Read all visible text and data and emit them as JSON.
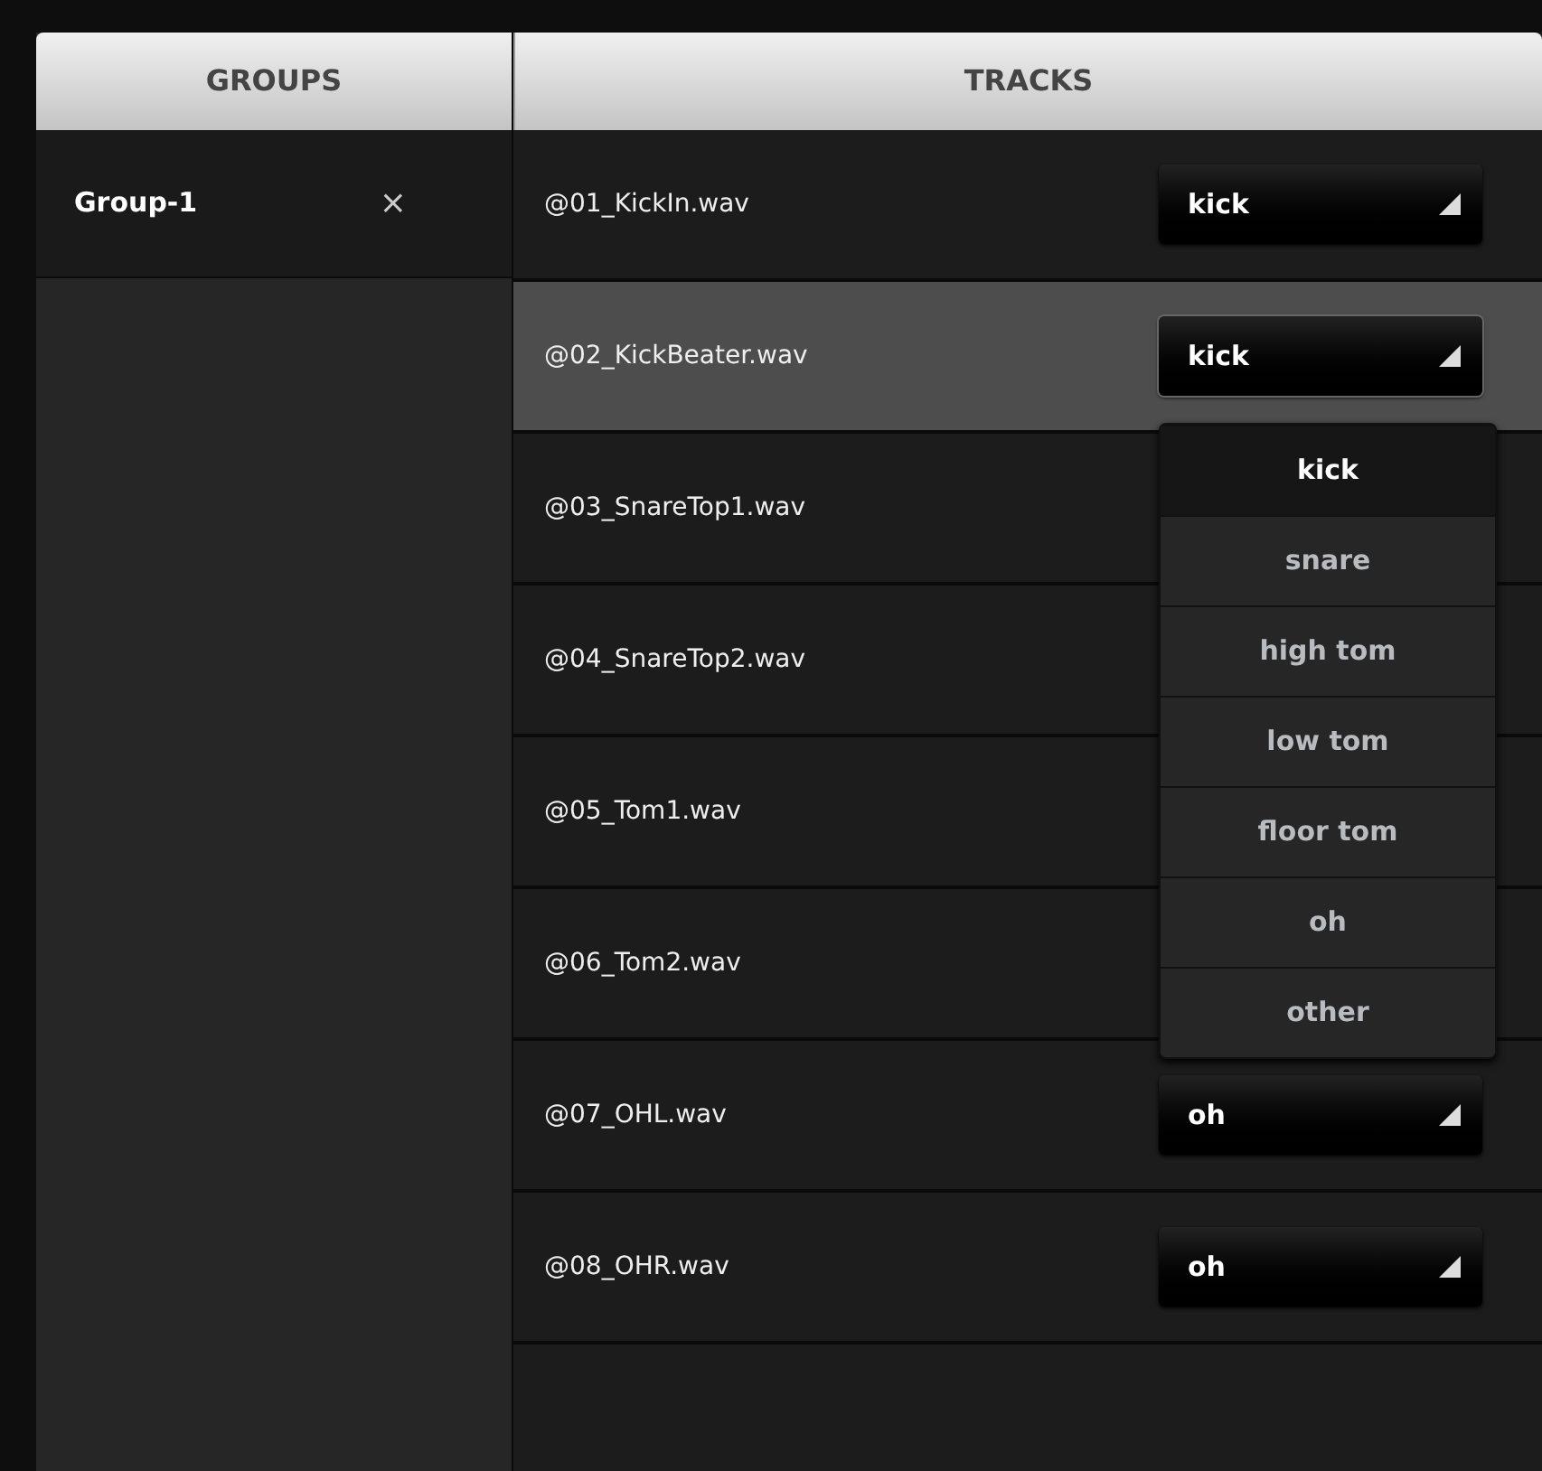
{
  "groups_header": "GROUPS",
  "tracks_header": "TRACKS",
  "groups": [
    {
      "name": "Group-1",
      "close": "×",
      "selected": true
    }
  ],
  "tracks": [
    {
      "name": "@01_KickIn.wav",
      "selected": false,
      "type": "kick"
    },
    {
      "name": "@02_KickBeater.wav",
      "selected": true,
      "type": "kick",
      "menu_open": true
    },
    {
      "name": "@03_SnareTop1.wav",
      "selected": false
    },
    {
      "name": "@04_SnareTop2.wav",
      "selected": false
    },
    {
      "name": "@05_Tom1.wav",
      "selected": false
    },
    {
      "name": "@06_Tom2.wav",
      "selected": false
    },
    {
      "name": "@07_OHL.wav",
      "selected": false,
      "type": "oh"
    },
    {
      "name": "@08_OHR.wav",
      "selected": false,
      "type": "oh"
    }
  ],
  "menu": [
    {
      "label": "kick",
      "selected": true
    },
    {
      "label": "snare",
      "selected": false
    },
    {
      "label": "high tom",
      "selected": false
    },
    {
      "label": "low tom",
      "selected": false
    },
    {
      "label": "floor tom",
      "selected": false
    },
    {
      "label": "oh",
      "selected": false
    },
    {
      "label": "other",
      "selected": false
    }
  ]
}
